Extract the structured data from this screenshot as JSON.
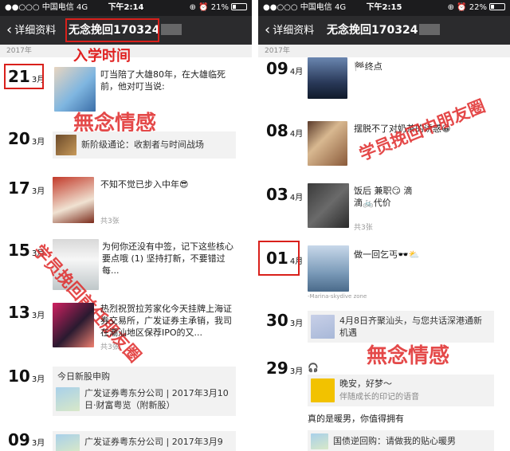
{
  "left": {
    "status": {
      "carrier": "●●○○○ 中国电信  4G",
      "time": "下午2:14",
      "right": "⊕ ⏰ 21%"
    },
    "nav": {
      "back": "详细资料",
      "title": "无念挽回170324"
    },
    "year": "2017年",
    "annotation": "入学时间",
    "entries": [
      {
        "day": "21",
        "month": "3月",
        "text": "叮当陪了大雄80年，在大雄临死前，他对叮当说:"
      },
      {
        "day": "20",
        "month": "3月",
        "share": "新阶级通论：收割者与时间战场"
      },
      {
        "day": "17",
        "month": "3月",
        "text": "不知不觉已步入中年😎",
        "count": "共3张"
      },
      {
        "day": "15",
        "month": "3月",
        "text": "为何你还没有中签，记下这些核心要点哦 (1) 坚持打新，不要错过每..."
      },
      {
        "day": "13",
        "month": "3月",
        "text": "热烈祝贺拉芳家化今天挂牌上海证券交易所，广发证券主承销，我司在潮汕地区保荐IPO的又...",
        "count": "共3张"
      },
      {
        "day": "10",
        "month": "3月",
        "text": "今日新股申购",
        "share": "广发证券粤东分公司 | 2017年3月10日·财富粤览（附新股）"
      },
      {
        "day": "09",
        "month": "3月",
        "share": "广发证券粤东分公司 | 2017年3月9"
      }
    ],
    "watermark1": "無念情感",
    "watermark2": "学员挽回前任朋友圈"
  },
  "right": {
    "status": {
      "carrier": "●●○○○ 中国电信  4G",
      "time": "下午2:15",
      "right": "⊕ ⏰ 22%"
    },
    "nav": {
      "back": "详细资料",
      "title": "无念挽回170324"
    },
    "year": "2017年",
    "entries": [
      {
        "day": "09",
        "month": "4月",
        "text": "🏁终点"
      },
      {
        "day": "08",
        "month": "4月",
        "text": "摆脱不了对奶茶的诱惑😀"
      },
      {
        "day": "03",
        "month": "4月",
        "text": "饭后 兼职😏 滴滴🚲代价",
        "count": "共3张"
      },
      {
        "day": "01",
        "month": "4月",
        "text": "做一回乞丐🕶️⛅",
        "caption": "-Marina-skydive zone"
      },
      {
        "day": "30",
        "month": "3月",
        "share": "4月8日齐聚汕头，与您共话深港通新机遇"
      },
      {
        "day": "29",
        "month": "3月",
        "text": "🎧",
        "share": "晚安，好梦～",
        "share_sub": "伴随成长的印记的语音"
      },
      {
        "text2": "真的是暖男，你值得拥有",
        "share2": "国债逆回购：请做我的贴心暖男"
      }
    ],
    "watermark1": "学员挽回中朋友圈",
    "watermark2": "無念情感"
  }
}
